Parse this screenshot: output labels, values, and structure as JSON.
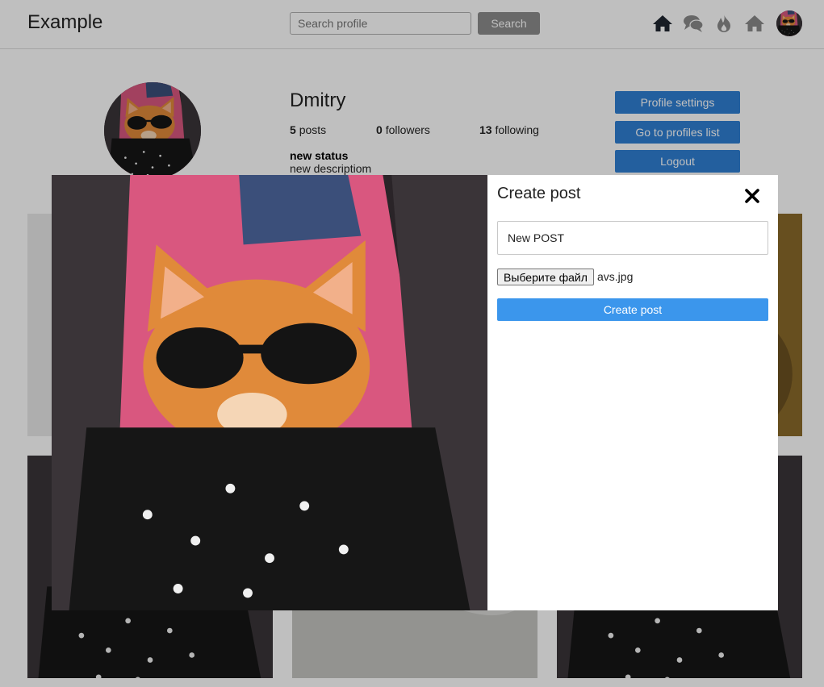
{
  "header": {
    "brand": "Example",
    "search": {
      "placeholder": "Search profile",
      "value": ""
    },
    "search_button": "Search",
    "nav_icons": [
      "home-icon",
      "chat-icon",
      "fire-icon",
      "house-icon"
    ]
  },
  "profile": {
    "name": "Dmitry",
    "stats": {
      "posts": {
        "count": "5",
        "label": "posts"
      },
      "followers": {
        "count": "0",
        "label": "followers"
      },
      "following": {
        "count": "13",
        "label": "following"
      }
    },
    "status_title": "new status",
    "status_description": "new descriptiom",
    "buttons": {
      "settings": "Profile settings",
      "profiles_list": "Go to profiles list",
      "logout": "Logout"
    }
  },
  "modal": {
    "title": "Create post",
    "post_text": {
      "value": "New POST",
      "placeholder": ""
    },
    "file_button": "Выберите файл",
    "file_name": "avs.jpg",
    "submit": "Create post"
  },
  "colors": {
    "primary": "#2f7fd3",
    "accent": "#3b96ec",
    "search_button": "#8c8c8c",
    "overlay": "rgba(0,0,0,0.25)"
  }
}
